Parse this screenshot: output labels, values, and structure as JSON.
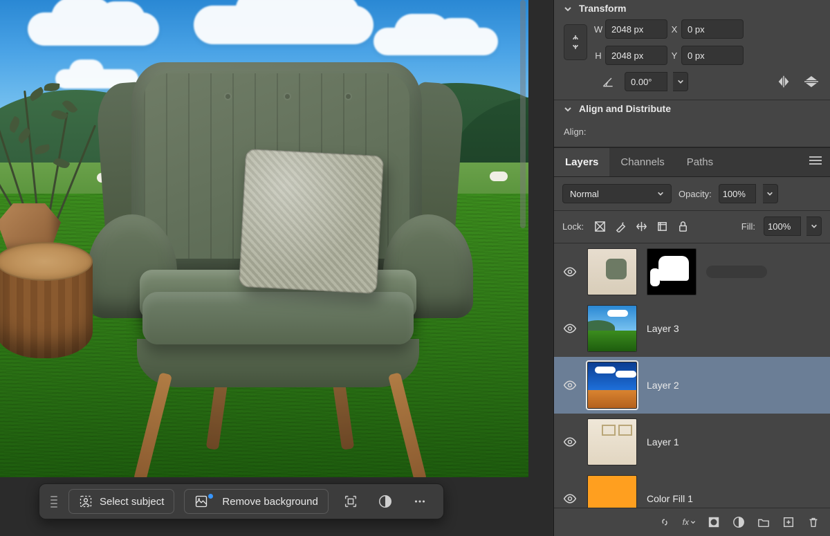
{
  "context_bar": {
    "select_subject": "Select subject",
    "remove_background": "Remove background"
  },
  "properties": {
    "transform": {
      "title": "Transform",
      "w_label": "W",
      "w_value": "2048 px",
      "h_label": "H",
      "h_value": "2048 px",
      "x_label": "X",
      "x_value": "0 px",
      "y_label": "Y",
      "y_value": "0 px",
      "angle_value": "0.00°"
    },
    "align": {
      "title": "Align and Distribute",
      "label": "Align:"
    }
  },
  "layers_panel": {
    "tabs": {
      "layers": "Layers",
      "channels": "Channels",
      "paths": "Paths"
    },
    "blend_mode": "Normal",
    "opacity_label": "Opacity:",
    "opacity_value": "100%",
    "lock_label": "Lock:",
    "fill_label": "Fill:",
    "fill_value": "100%",
    "layers": [
      {
        "name": "",
        "masked": true
      },
      {
        "name": "Layer 3"
      },
      {
        "name": "Layer 2",
        "selected": true
      },
      {
        "name": "Layer 1"
      },
      {
        "name": "Color Fill 1"
      }
    ]
  }
}
